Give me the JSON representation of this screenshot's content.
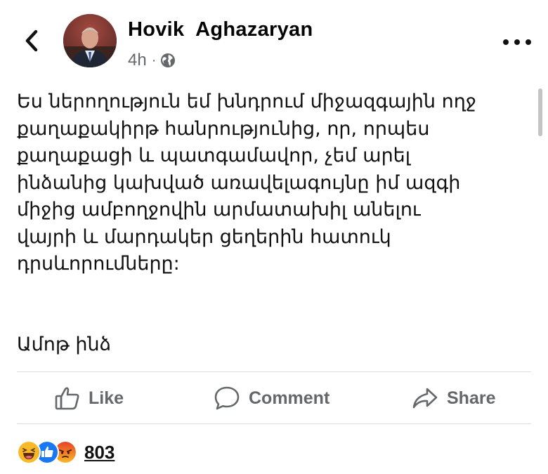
{
  "header": {
    "author_name": "Hovik  Aghazaryan",
    "time": "4h",
    "separator": "·",
    "privacy_icon": "globe-icon",
    "back_icon": "chevron-left-icon",
    "more_icon": "ellipsis-icon"
  },
  "post": {
    "lines": [
      "Ես ներողություն եմ խնդրում միջազգային ողջ",
      "քաղաքակիրթ հանրությունից, որ, որպես",
      "քաղաքացի և պատգամավոր, չեմ արել",
      "ինձանից կախված առավելագույնը իմ ազգի",
      "միջից ամբողջովին արմատախիլ անելու",
      "վայրի և մարդակեր ցեղերին հատուկ",
      "դրսևորումները:"
    ],
    "signature": "Ամոթ ինձ"
  },
  "actions": {
    "like_label": "Like",
    "comment_label": "Comment",
    "share_label": "Share"
  },
  "reactions": {
    "icons": [
      "haha-reaction-icon",
      "like-reaction-icon",
      "angry-reaction-icon"
    ],
    "count": "803"
  },
  "colors": {
    "text": "#050505",
    "secondary_text": "#65676b",
    "divider": "#dadde1",
    "like_blue": "#1877f2",
    "haha_yellow": "#f7b928",
    "angry_orange": "#e9710f"
  }
}
